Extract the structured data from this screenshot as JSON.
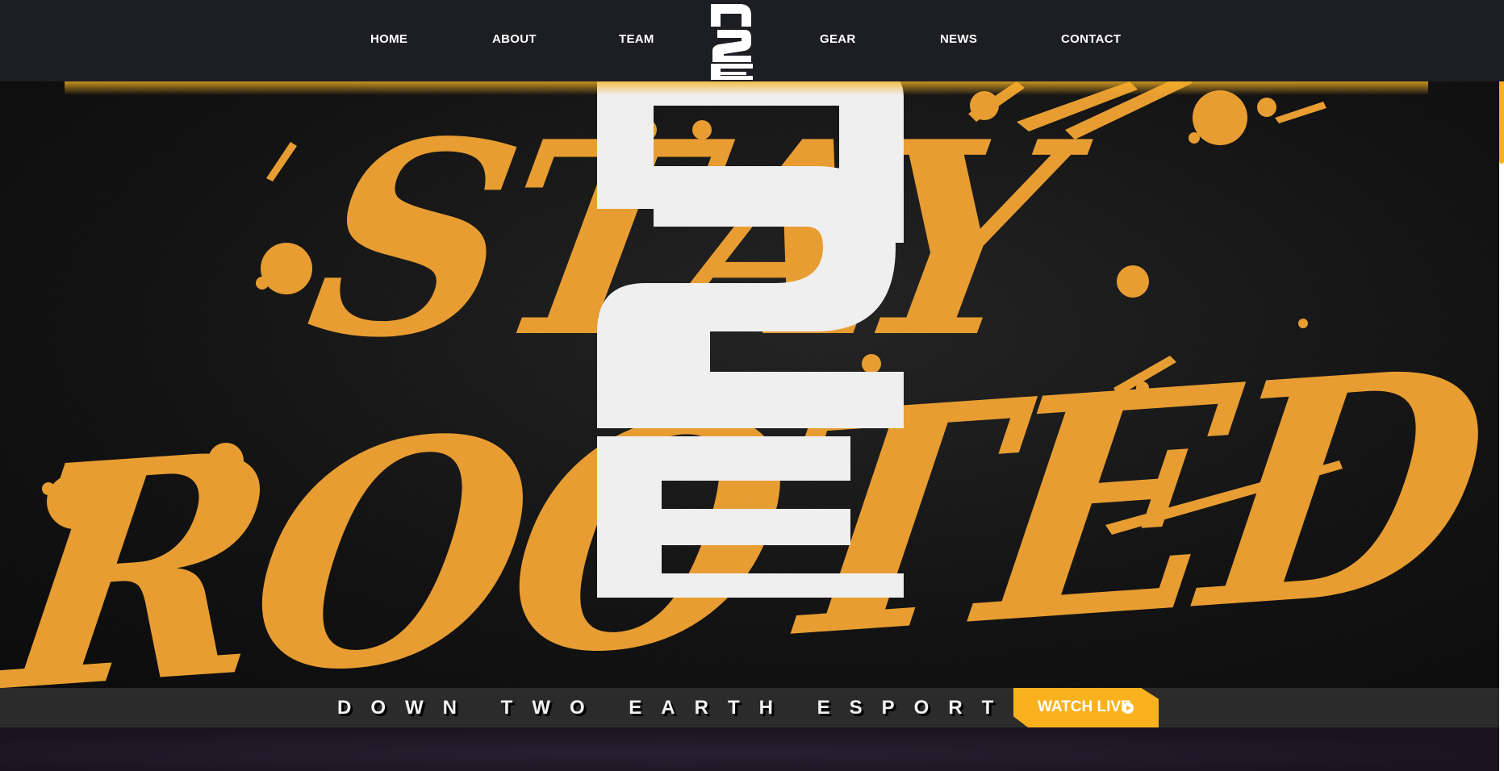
{
  "nav": {
    "items": [
      {
        "label": "HOME"
      },
      {
        "label": "ABOUT"
      },
      {
        "label": "TEAM"
      },
      {
        "label": "GEAR"
      },
      {
        "label": "NEWS"
      },
      {
        "label": "CONTACT"
      }
    ],
    "logo_text": "D2E"
  },
  "hero": {
    "graffiti_line1": "STAY",
    "graffiti_line2": "ROOTED",
    "emblem_text": "D2E"
  },
  "ticker": {
    "text": "DOWN TWO EARTH ESPORTS",
    "watch_label": "WATCH LIVE",
    "watch_icon": "play-circle-icon"
  },
  "colors": {
    "accent": "#f9b21e",
    "graffiti": "#e89d32",
    "nav_bg": "#1d1d24",
    "ticker_bg": "#2b2b2b",
    "emblem": "#efefef"
  }
}
